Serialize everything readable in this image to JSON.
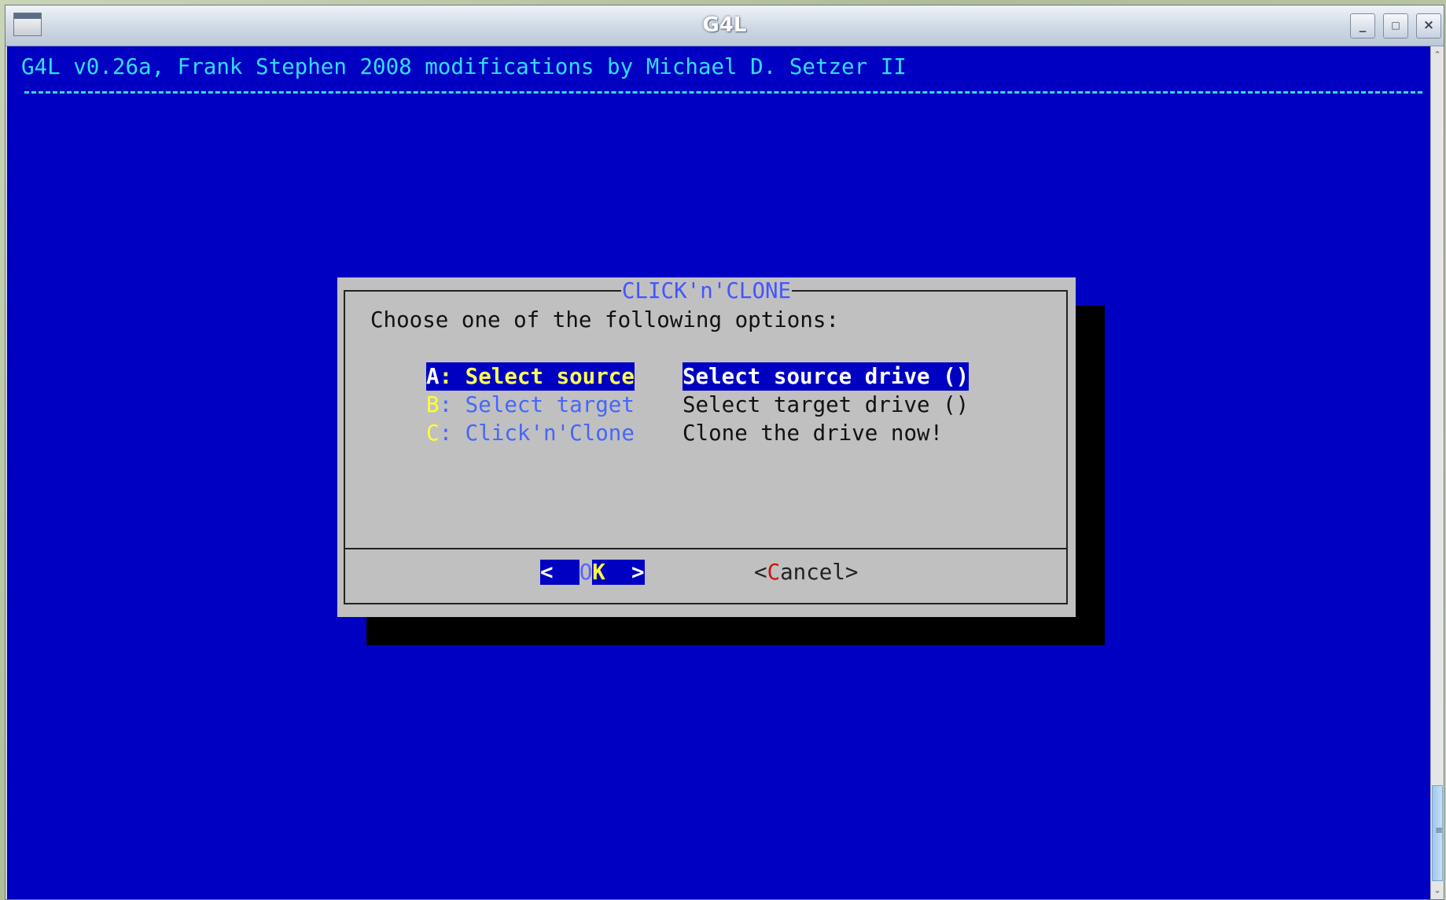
{
  "window": {
    "title": "G4L",
    "controls": {
      "minimize": "_",
      "maximize": "□",
      "close": "×"
    }
  },
  "terminal": {
    "header": "G4L v0.26a, Frank Stephen 2008 modifications by Michael D. Setzer II",
    "colors": {
      "background": "#0000c2",
      "header": "#33ddff"
    }
  },
  "dialog": {
    "title": "CLICK'n'CLONE",
    "prompt": "Choose one of the following options:",
    "items": [
      {
        "key": "A",
        "tag_rest": ": Select source",
        "description": "Select source drive ()",
        "selected": true
      },
      {
        "key": "B",
        "tag_rest": ": Select target",
        "description": "Select target drive ()",
        "selected": false
      },
      {
        "key": "C",
        "tag_rest": ": Click'n'Clone",
        "description": "Clone the drive now!",
        "selected": false
      }
    ],
    "buttons": {
      "ok": {
        "left": "<",
        "o": "O",
        "k": "K",
        "right": ">"
      },
      "cancel": {
        "open": "<",
        "hot": "C",
        "rest": "ancel",
        "close": ">"
      }
    }
  }
}
